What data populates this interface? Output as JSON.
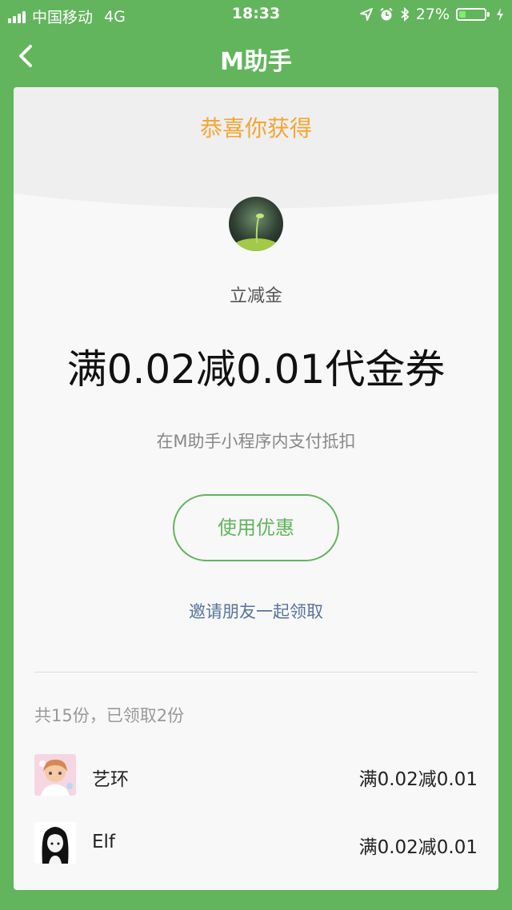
{
  "status_bar": {
    "carrier": "中国移动",
    "network": "4G",
    "time": "18:33",
    "battery_percent": "27%",
    "battery_level": 0.27
  },
  "nav": {
    "title": "M助手"
  },
  "card": {
    "congrats": "恭喜你获得",
    "coupon_type": "立减金",
    "coupon_amount": "满0.02减0.01代金券",
    "coupon_desc": "在M助手小程序内支付抵扣",
    "use_button": "使用优惠",
    "invite_link": "邀请朋友一起领取",
    "claim_summary": "共15份，已领取2份"
  },
  "claims": [
    {
      "name": "艺环",
      "reward": "满0.02减0.01"
    },
    {
      "name": "Elf",
      "reward": "满0.02减0.01"
    }
  ],
  "colors": {
    "brand_green": "#62b55c",
    "congrats_orange": "#f5a533",
    "link_blue": "#59739b"
  }
}
